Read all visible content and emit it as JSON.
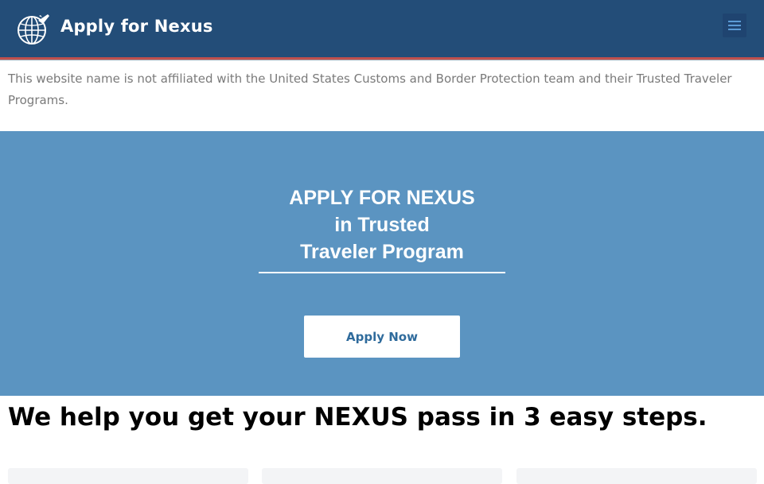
{
  "header": {
    "site_title": "Apply for Nexus",
    "logo_icon": "globe-airplane-icon",
    "menu_icon": "hamburger-menu-icon",
    "colors": {
      "background": "#234d78",
      "accent_stripe": "#c0504d"
    }
  },
  "disclaimer": {
    "text": "This website name is not affiliated with the United States Customs and Border Protection team and their Trusted Traveler Programs."
  },
  "hero": {
    "title_lines": [
      "APPLY FOR NEXUS",
      "in Trusted",
      "Traveler Program"
    ],
    "button_label": "Apply Now",
    "colors": {
      "background": "#5b94c1",
      "button_text": "#2f6b9c"
    }
  },
  "steps": {
    "heading": "We help you get your NEXUS pass in 3 easy steps."
  }
}
